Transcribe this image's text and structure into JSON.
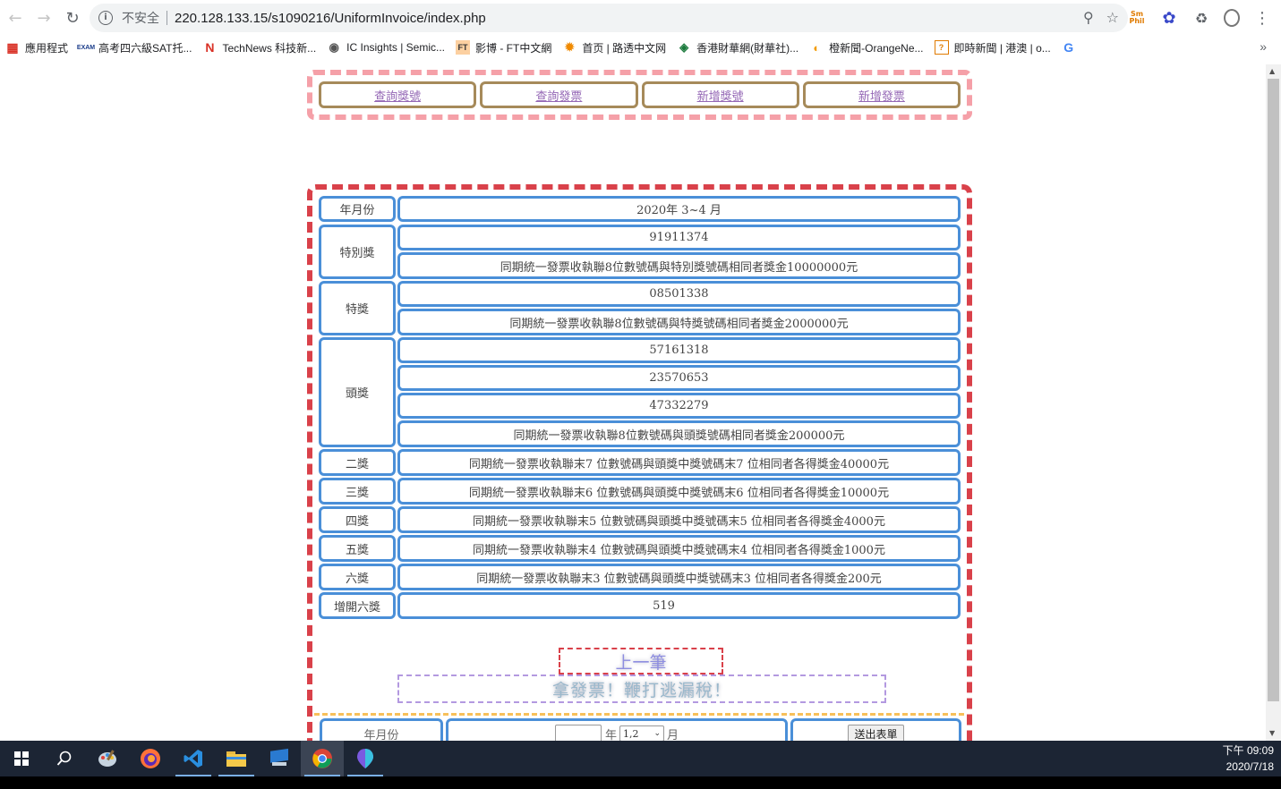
{
  "browser": {
    "security_label": "不安全",
    "url": "220.128.133.15/s1090216/UniformInvoice/index.php",
    "bookmarks": [
      {
        "label": "應用程式",
        "icon": "apps-grid-icon"
      },
      {
        "label": "高考四六級SAT托...",
        "icon": "exam4us-icon"
      },
      {
        "label": "TechNews 科技新...",
        "icon": "technews-icon"
      },
      {
        "label": "IC Insights | Semic...",
        "icon": "icinsights-icon"
      },
      {
        "label": "影博 - FT中文網",
        "icon": "ft-icon"
      },
      {
        "label": "首页 | 路透中文网",
        "icon": "reuters-icon"
      },
      {
        "label": "香港財華網(財華社)...",
        "icon": "finet-icon"
      },
      {
        "label": "橙新聞-OrangeNe...",
        "icon": "orange-news-icon"
      },
      {
        "label": "即時新聞 | 港澳 | o...",
        "icon": "oncc-icon"
      },
      {
        "label": "",
        "icon": "google-icon"
      }
    ]
  },
  "nav": {
    "links": [
      "查詢獎號",
      "查詢發票",
      "新增獎號",
      "新增發票"
    ]
  },
  "prize": {
    "period_label": "年月份",
    "period_value": "2020年 3~4 月",
    "special": {
      "label": "特別獎",
      "number": "91911374",
      "desc": "同期統一發票收執聯8位數號碼與特別獎號碼相同者獎金10000000元"
    },
    "grand": {
      "label": "特獎",
      "number": "08501338",
      "desc": "同期統一發票收執聯8位數號碼與特獎號碼相同者獎金2000000元"
    },
    "first": {
      "label": "頭獎",
      "numbers": [
        "57161318",
        "23570653",
        "47332279"
      ],
      "desc": "同期統一發票收執聯8位數號碼與頭獎號碼相同者獎金200000元"
    },
    "second": {
      "label": "二獎",
      "desc": "同期統一發票收執聯末7 位數號碼與頭獎中獎號碼末7 位相同者各得獎金40000元"
    },
    "third": {
      "label": "三獎",
      "desc": "同期統一發票收執聯末6 位數號碼與頭獎中獎號碼末6 位相同者各得獎金10000元"
    },
    "fourth": {
      "label": "四獎",
      "desc": "同期統一發票收執聯末5 位數號碼與頭獎中獎號碼末5 位相同者各得獎金4000元"
    },
    "fifth": {
      "label": "五獎",
      "desc": "同期統一發票收執聯末4 位數號碼與頭獎中獎號碼末4 位相同者各得獎金1000元"
    },
    "sixth": {
      "label": "六獎",
      "desc": "同期統一發票收執聯末3 位數號碼與頭獎中獎號碼末3 位相同者各得獎金200元"
    },
    "extra_sixth": {
      "label": "增開六獎",
      "number": "519"
    }
  },
  "prev_button": "上一筆",
  "slogan": "拿發票！鞭打逃漏稅！",
  "form": {
    "label": "年月份",
    "year_unit": "年",
    "month_value": "1,2",
    "month_unit": "月",
    "submit": "送出表單"
  },
  "taskbar": {
    "time": "下午 09:09",
    "date": "2020/7/18"
  }
}
